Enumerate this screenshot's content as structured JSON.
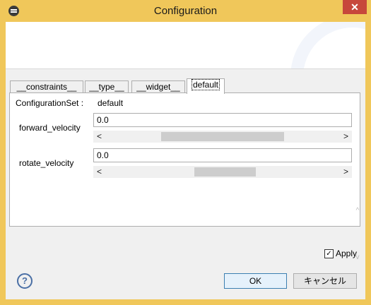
{
  "window": {
    "title": "Configuration",
    "close_glyph": "✕"
  },
  "tabs": [
    {
      "label": "__constraints__"
    },
    {
      "label": "__type__"
    },
    {
      "label": "__widget__"
    },
    {
      "label": "default"
    }
  ],
  "config_set": {
    "label": "ConfigurationSet :",
    "value": "default"
  },
  "params": [
    {
      "label": "forward_velocity",
      "value": "0.0"
    },
    {
      "label": "rotate_velocity",
      "value": "0.0"
    }
  ],
  "apply": {
    "label": "Apply",
    "checked": true,
    "check_glyph": "✓"
  },
  "help_glyph": "?",
  "buttons": {
    "ok": "OK",
    "cancel": "キャンセル"
  },
  "scroll_glyphs": {
    "left": "<",
    "right": ">",
    "up": "^",
    "down": "v"
  }
}
